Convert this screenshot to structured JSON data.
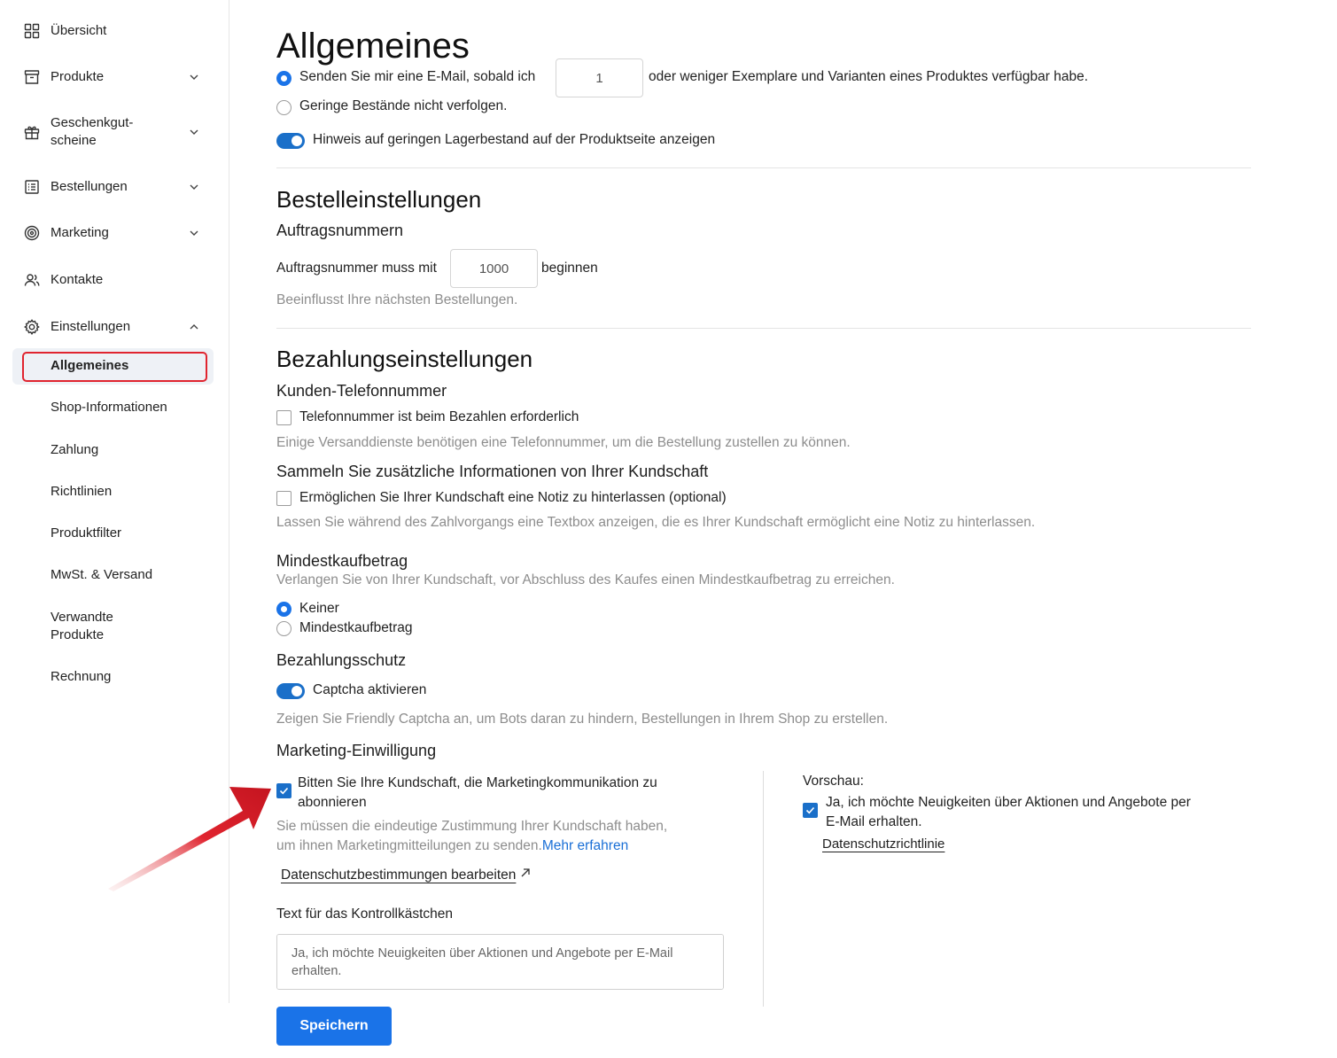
{
  "sidebar": {
    "items": [
      {
        "label": "Übersicht",
        "icon": "grid-icon"
      },
      {
        "label": "Produkte",
        "icon": "box-icon"
      },
      {
        "label_line1": "Geschenkgut-",
        "label_line2": "scheine",
        "icon": "gift-icon"
      },
      {
        "label": "Bestellungen",
        "icon": "list-icon"
      },
      {
        "label": "Marketing",
        "icon": "target-icon"
      },
      {
        "label": "Kontakte",
        "icon": "users-icon"
      },
      {
        "label": "Einstellungen",
        "icon": "gear-icon"
      }
    ],
    "sub_items": [
      "Allgemeines",
      "Shop-Informationen",
      "Zahlung",
      "Richtlinien",
      "Produktfilter",
      "MwSt. & Versand",
      "Verwandte",
      "Produkte",
      "Rechnung"
    ]
  },
  "main": {
    "title": "Allgemeines",
    "stock": {
      "radio_email_prefix": "Senden Sie mir eine E-Mail, sobald ich",
      "radio_email_value": "1",
      "radio_email_suffix": "oder weniger Exemplare und Varianten eines Produktes verfügbar habe.",
      "radio_none": "Geringe Bestände nicht verfolgen.",
      "toggle_label": "Hinweis auf geringen Lagerbestand auf der Produktseite anzeigen"
    },
    "order": {
      "heading": "Bestelleinstellungen",
      "subheading": "Auftragsnummern",
      "prefix": "Auftragsnummer muss mit",
      "value": "1000",
      "suffix": "beginnen",
      "hint": "Beeinflusst Ihre nächsten Bestellungen."
    },
    "payment": {
      "heading": "Bezahlungseinstellungen",
      "phone_heading": "Kunden-Telefonnummer",
      "phone_check": "Telefonnummer ist beim Bezahlen erforderlich",
      "phone_hint": "Einige Versanddienste benötigen eine Telefonnummer, um die Bestellung zustellen zu können.",
      "info_heading": "Sammeln Sie zusätzliche Informationen von Ihrer Kundschaft",
      "info_check": "Ermöglichen Sie Ihrer Kundschaft eine Notiz zu hinterlassen (optional)",
      "info_hint": "Lassen Sie während des Zahlvorgangs eine Textbox anzeigen, die es Ihrer Kundschaft ermöglicht eine Notiz zu hinterlassen.",
      "min_heading": "Mindestkaufbetrag",
      "min_hint": "Verlangen Sie von Ihrer Kundschaft, vor Abschluss des Kaufes einen Mindestkaufbetrag zu erreichen.",
      "min_opt1": "Keiner",
      "min_opt2": "Mindestkaufbetrag",
      "protect_heading": "Bezahlungsschutz",
      "captcha_label": "Captcha aktivieren",
      "captcha_hint": "Zeigen Sie Friendly Captcha an, um Bots daran zu hindern, Bestellungen in Ihrem Shop zu erstellen."
    },
    "marketing": {
      "heading": "Marketing-Einwilligung",
      "check_line1": "Bitten Sie Ihre Kundschaft, die Marketingkommunikation zu",
      "check_line2": "abonnieren",
      "hint_line1": "Sie müssen die eindeutige Zustimmung Ihrer Kundschaft haben,",
      "hint_line2": "um ihnen Marketingmitteilungen zu senden.",
      "learn_more": "Mehr erfahren",
      "privacy_edit": "Datenschutzbestimmungen bearbeiten",
      "checkbox_text_label": "Text für das Kontrollkästchen",
      "checkbox_text_value": "Ja, ich möchte Neuigkeiten über Aktionen und Angebote per E-Mail erhalten.",
      "preview_label": "Vorschau:",
      "preview_line1": "Ja, ich möchte Neuigkeiten über Aktionen und Angebote per",
      "preview_line2": "E-Mail erhalten.",
      "preview_privacy": "Datenschutzrichtlinie"
    },
    "save_label": "Speichern"
  },
  "colors": {
    "accent": "#1a73e8",
    "highlight_box": "#e0242f",
    "arrow": "#e0242f"
  }
}
